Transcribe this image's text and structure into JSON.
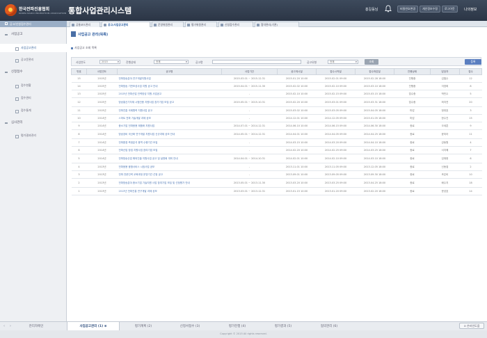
{
  "header": {
    "org_name": "한국전파진흥협회",
    "org_sub": "KOREA RADIO PROMOTION ASSOCIATION",
    "system_title": "통합사업관리시스템",
    "user_name": "홍길동님",
    "buttons": [
      "비밀번호변경",
      "개인정보수정",
      "로그아웃"
    ],
    "my_info": "나의정보"
  },
  "left_crumb": "공고/신청접수관리",
  "window_tabs": [
    {
      "label": "공통코드관리",
      "active": false
    },
    {
      "label": "공고/사업공고관리",
      "active": true
    },
    {
      "label": "운영위원관리",
      "active": false
    },
    {
      "label": "평가위원관리",
      "active": false
    },
    {
      "label": "신청접수관리",
      "active": false
    },
    {
      "label": "협약관리(기관)",
      "active": false
    }
  ],
  "sidebar": {
    "sections": [
      {
        "label": "사업공고",
        "items": [
          {
            "label": "사업공고관리",
            "active": true
          },
          {
            "label": "공고문관리",
            "active": false
          }
        ]
      },
      {
        "label": "신청접수",
        "items": [
          {
            "label": "접수현황",
            "active": false
          },
          {
            "label": "접수관리",
            "active": false
          },
          {
            "label": "접수통계",
            "active": false
          }
        ]
      },
      {
        "label": "심사관리",
        "items": [
          {
            "label": "평가결과관리",
            "active": false
          }
        ]
      }
    ]
  },
  "main": {
    "title": "사업공고 관리(목록)",
    "subheader": "사업공고 조회 목록",
    "filters": {
      "year_label": "사업연도",
      "year_value": "2015",
      "status_label": "진행상태",
      "status_value": "전체",
      "keyword_label": "공고명",
      "type_label": "공고유형",
      "type_value": "전체"
    },
    "search_button": "조회",
    "register_button": "등록",
    "columns": [
      "번호",
      "사업연도",
      "공고명",
      "사업기간",
      "공고게시일",
      "접수시작일",
      "접수마감일",
      "진행상태",
      "담당자",
      "접수"
    ],
    "rows": [
      {
        "no": "15",
        "year": "2015년",
        "title": "전파방송분야 연구개발지원사업",
        "period": "2015.03.01 ~ 2015.12.31",
        "post": "2015.01.20 10:00",
        "start": "2015.02.01 09:00",
        "end": "2015.02.28 18:00",
        "status": "진행중",
        "manager": "김철수",
        "count": "12",
        "tall": false
      },
      {
        "no": "14",
        "year": "2015년",
        "title": "전파방송 기반조성사업 지원 공고 안내",
        "period": "2015.04.01 ~ 2015.11.30",
        "post": "2015.02.02 10:00",
        "start": "2015.02.10 09:00",
        "end": "2015.03.10 18:00",
        "status": "진행중",
        "manager": "이영희",
        "count": "8",
        "tall": false
      },
      {
        "no": "13",
        "year": "2015년",
        "title": "2015년 전파산업 인력양성 지원 사업공고",
        "period": "-",
        "post": "2015.02.10 10:00",
        "start": "2015.02.15 09:00",
        "end": "2015.03.15 18:00",
        "status": "접수중",
        "manager": "박민수",
        "count": "5",
        "tall": false
      },
      {
        "no": "12",
        "year": "2015년",
        "title": "방송통신기자재 시험인증 지원사업 참가기업 모집 공고",
        "period": "2015.05.01 ~ 2015.10.31",
        "post": "2015.02.20 10:00",
        "start": "2015.03.01 09:00",
        "end": "2015.03.31 18:00",
        "status": "접수중",
        "manager": "최지연",
        "count": "20",
        "tall": true
      },
      {
        "no": "11",
        "year": "2015년",
        "title": "전파진흥 국제협력 지원사업 공고",
        "period": "-",
        "post": "2015.03.02 10:00",
        "start": "2015.03.05 09:00",
        "end": "2015.04.05 18:00",
        "status": "마감",
        "manager": "정대호",
        "count": "3",
        "tall": false
      },
      {
        "no": "10",
        "year": "2014년",
        "title": "스마트 전파 기술개발 과제 공모",
        "period": "-",
        "post": "2014.12.01 10:00",
        "start": "2014.12.05 09:00",
        "end": "2015.01.05 18:00",
        "status": "마감",
        "manager": "한수진",
        "count": "15",
        "tall": false
      },
      {
        "no": "9",
        "year": "2014년",
        "title": "중소기업 전파응용 제품화 지원사업",
        "period": "2014.07.01 ~ 2014.12.31",
        "post": "2014.06.10 10:00",
        "start": "2014.06.15 09:00",
        "end": "2014.06.30 18:00",
        "status": "종료",
        "manager": "오세훈",
        "count": "9",
        "tall": false
      },
      {
        "no": "8",
        "year": "2014년",
        "title": "방송장비 국산화 연구개발 지원사업 신규과제 공모 안내",
        "period": "2014.05.01 ~ 2014.12.31",
        "post": "2014.04.01 10:00",
        "start": "2014.04.05 09:00",
        "end": "2014.04.25 18:00",
        "status": "종료",
        "manager": "윤미라",
        "count": "11",
        "tall": true
      },
      {
        "no": "7",
        "year": "2014년",
        "title": "전파환경 측정분석 용역 수행기관 모집",
        "period": "-",
        "post": "2014.03.15 10:00",
        "start": "2014.03.20 09:00",
        "end": "2014.04.10 18:00",
        "status": "종료",
        "manager": "강동원",
        "count": "4",
        "tall": false
      },
      {
        "no": "6",
        "year": "2014년",
        "title": "전파산업 창업 지원사업 참여기업 모집",
        "period": "-",
        "post": "2014.02.20 10:00",
        "start": "2014.02.25 09:00",
        "end": "2014.03.25 18:00",
        "status": "종료",
        "manager": "서지혜",
        "count": "7",
        "tall": false
      },
      {
        "no": "5",
        "year": "2014년",
        "title": "전파방송산업 해외진출 지원사업 공고 및 설명회 개최 안내",
        "period": "2014.04.01 ~ 2014.10.31",
        "post": "2014.02.01 10:00",
        "start": "2014.02.10 09:00",
        "end": "2014.03.10 18:00",
        "status": "종료",
        "manager": "임재현",
        "count": "6",
        "tall": true
      },
      {
        "no": "4",
        "year": "2013년",
        "title": "전파응용 융합서비스 시범사업 공모",
        "period": "-",
        "post": "2013.11.01 10:00",
        "start": "2013.11.05 09:00",
        "end": "2013.12.05 18:00",
        "status": "종료",
        "manager": "신동엽",
        "count": "2",
        "tall": false
      },
      {
        "no": "3",
        "year": "2013년",
        "title": "전파 전문인력 교육과정 운영기관 선정 공고",
        "period": "-",
        "post": "2013.09.01 10:00",
        "start": "2013.09.05 09:00",
        "end": "2013.09.30 18:00",
        "status": "종료",
        "manager": "조은비",
        "count": "10",
        "tall": false
      },
      {
        "no": "2",
        "year": "2013년",
        "title": "전파방송분야 중소기업 기술지원 사업 참여기업 모집 및 선정평가 안내",
        "period": "2013.05.01 ~ 2013.11.30",
        "post": "2013.03.20 10:00",
        "start": "2013.03.25 09:00",
        "end": "2013.04.25 18:00",
        "status": "종료",
        "manager": "배수지",
        "count": "18",
        "tall": true
      },
      {
        "no": "1",
        "year": "2013년",
        "title": "2013년 전파진흥 연구개발 과제 공모",
        "period": "2013.03.01 ~ 2013.12.31",
        "post": "2013.01.15 10:00",
        "start": "2013.01.20 09:00",
        "end": "2013.02.20 18:00",
        "status": "종료",
        "manager": "문성호",
        "count": "14",
        "tall": false
      }
    ]
  },
  "bottom_tabs": [
    {
      "label": "관리자메인",
      "active": false
    },
    {
      "label": "사업공고관리 (1)",
      "active": true
    },
    {
      "label": "평가계획 (2)",
      "active": false
    },
    {
      "label": "신청서접수 (3)",
      "active": false
    },
    {
      "label": "평가진행 (4)",
      "active": false
    },
    {
      "label": "평가결과 (5)",
      "active": false
    },
    {
      "label": "협약관리 (6)",
      "active": false
    }
  ],
  "help_button": "온라인도움",
  "footer": "Copyright © 2015 All rights reserved."
}
